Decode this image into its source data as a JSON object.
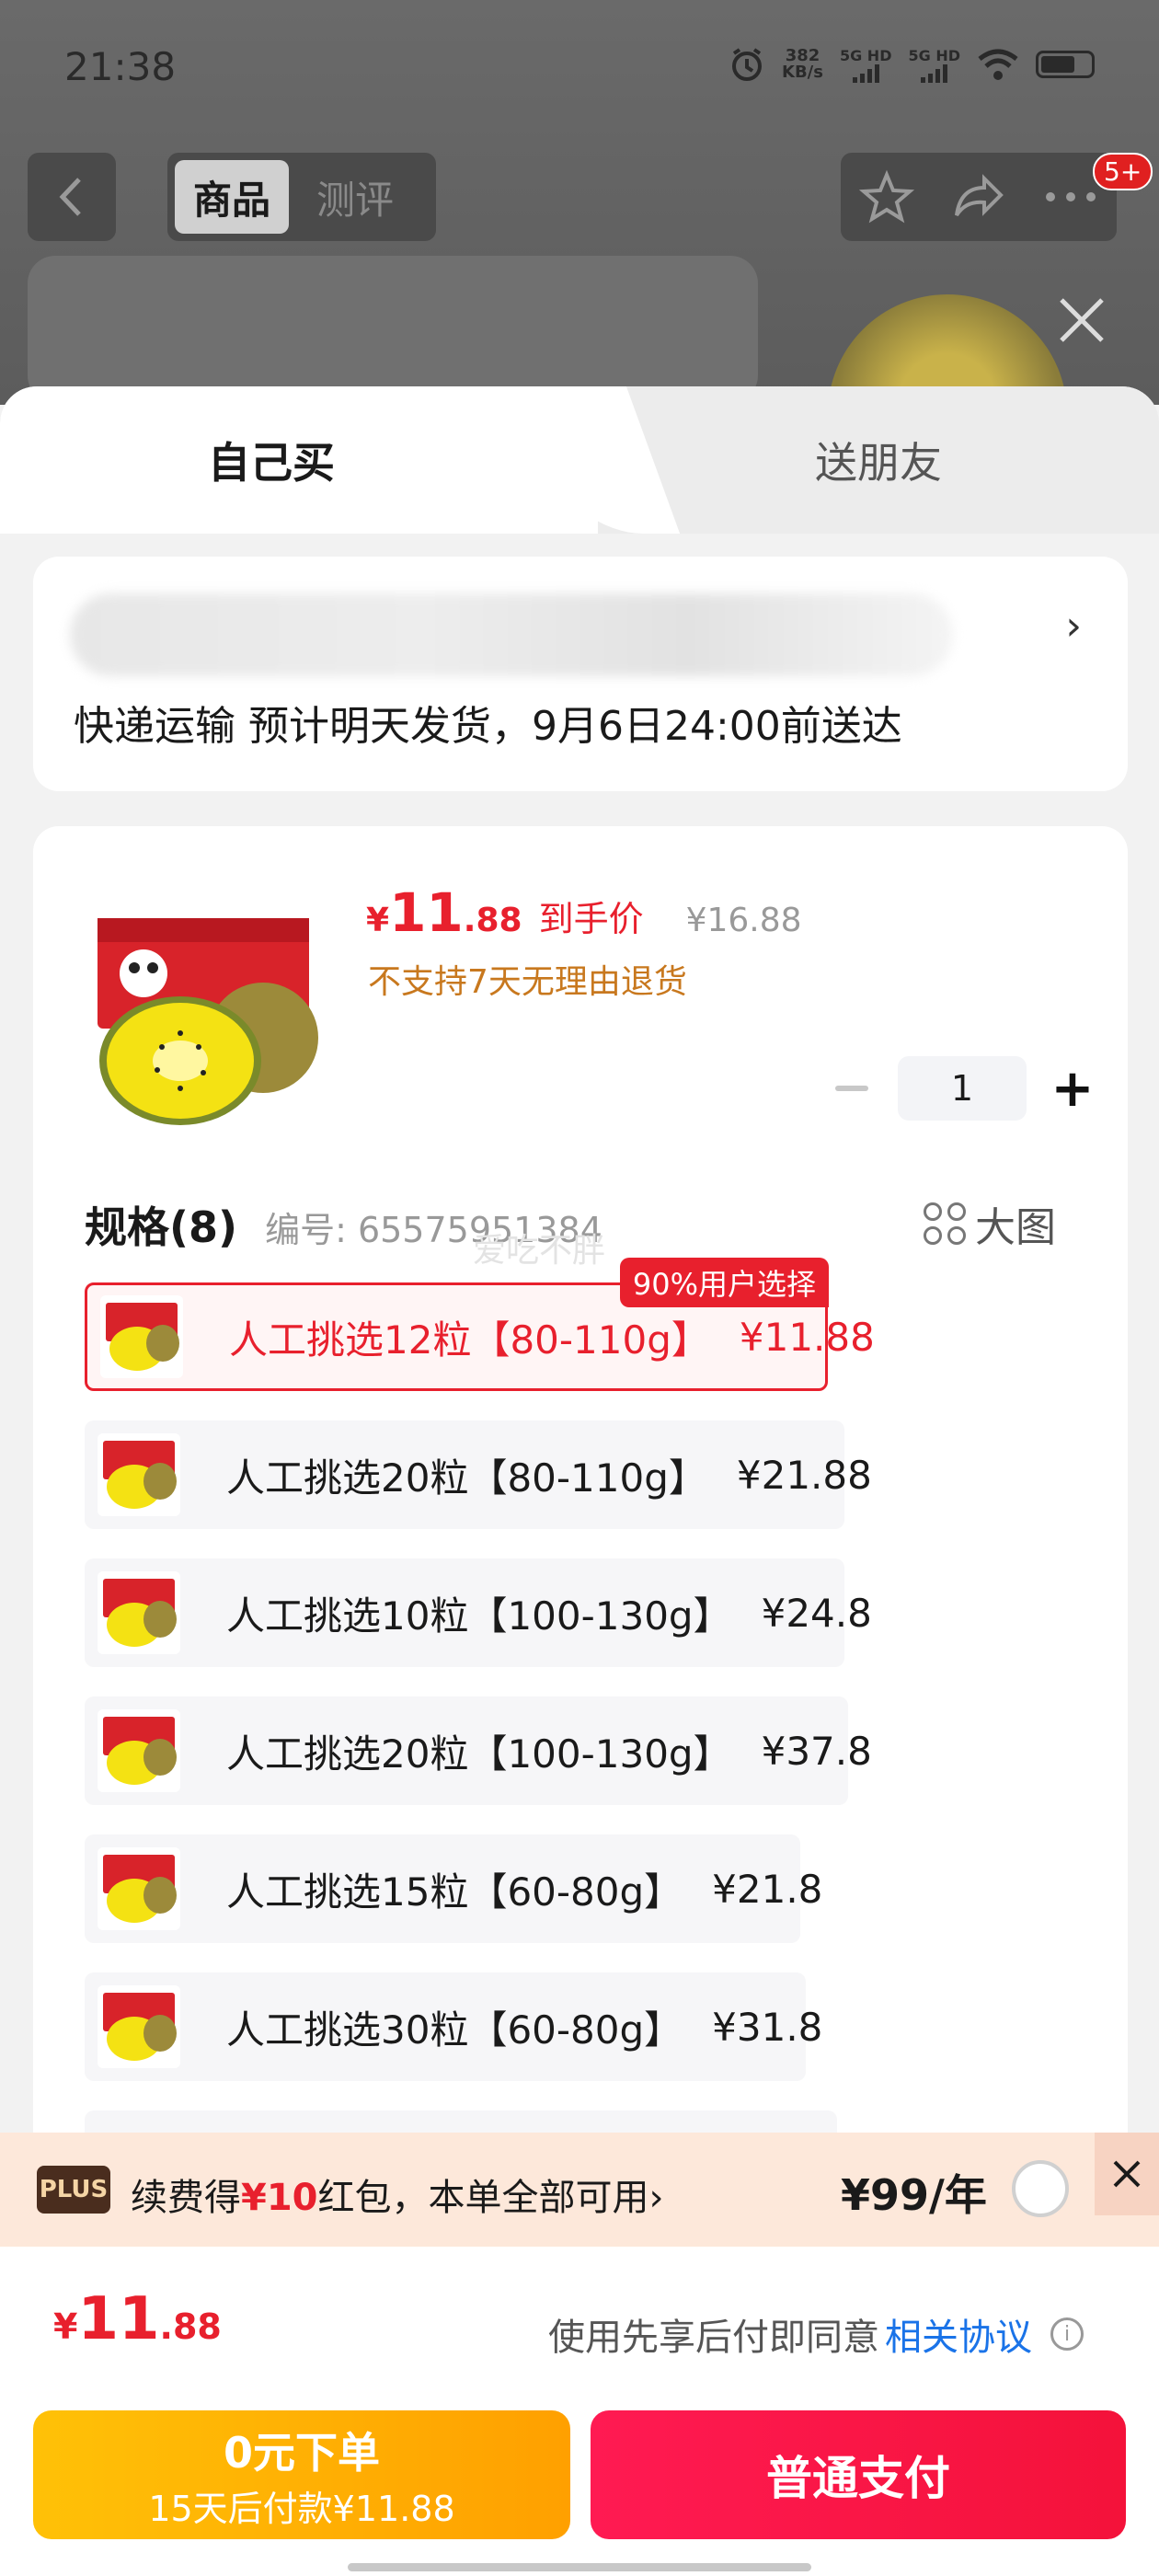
{
  "status_bar": {
    "time": "21:38",
    "net_speed": "382",
    "net_unit": "KB/s",
    "sim1": "5G HD",
    "sim2": "5G HD"
  },
  "nav": {
    "tabs": [
      "商品",
      "测评"
    ],
    "badge": "5+"
  },
  "sheet": {
    "tab_self": "自己买",
    "tab_friend": "送朋友"
  },
  "delivery": {
    "arrow": "›",
    "text": "快递运输 预计明天发货，9月6日24:00前送达"
  },
  "product": {
    "price_currency": "¥",
    "price_int": "11",
    "price_dec": ".88",
    "price_tag": "到手价",
    "original_price": "¥16.88",
    "return_policy": "不支持7天无理由退货",
    "quantity": "1"
  },
  "spec": {
    "title": "规格(8)",
    "code": "编号: 65575951384",
    "big_view": "大图",
    "watermark": "爱吃不胖",
    "selected_badge": "90%用户选择",
    "items": [
      {
        "label": "人工挑选12粒【80-110g】",
        "price": "¥11.88"
      },
      {
        "label": "人工挑选20粒【80-110g】",
        "price": "¥21.88"
      },
      {
        "label": "人工挑选10粒【100-130g】",
        "price": "¥24.8"
      },
      {
        "label": "人工挑选20粒【100-130g】",
        "price": "¥37.8"
      },
      {
        "label": "人工挑选15粒【60-80g】",
        "price": "¥21.8"
      },
      {
        "label": "人工挑选30粒【60-80g】",
        "price": "¥31.8"
      }
    ]
  },
  "plus": {
    "logo": "PLUS",
    "text_prefix": "续费得",
    "text_amount": "¥10",
    "text_suffix": "红包，本单全部可用",
    "text_arrow": "›",
    "price": "¥99/年"
  },
  "pay": {
    "total_currency": "¥",
    "total_int": "11",
    "total_dec": ".88",
    "agree_text": "使用先享后付即同意",
    "agree_link": "相关协议",
    "later_line1": "0元下单",
    "later_line2": "15天后付款¥11.88",
    "pay_label": "普通支付"
  },
  "colors": {
    "accent_red": "#e8202d",
    "pay_red": "#f4123a",
    "later_yellow": "#ffb300",
    "warning_orange": "#c8781e",
    "link_blue": "#1a73e8"
  }
}
